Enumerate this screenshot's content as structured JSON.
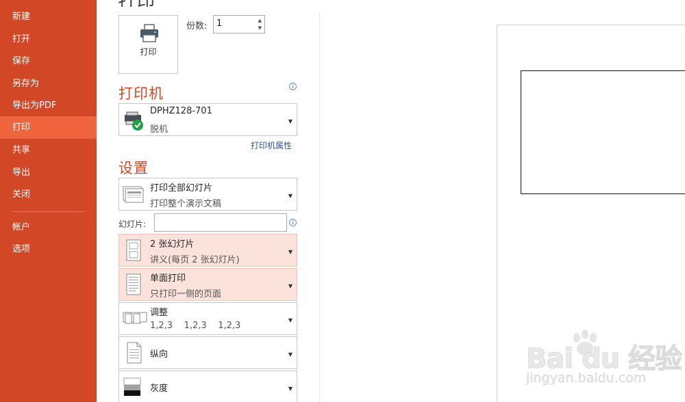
{
  "sidebar": {
    "items": [
      {
        "label": "新建"
      },
      {
        "label": "打开"
      },
      {
        "label": "保存"
      },
      {
        "label": "另存为"
      },
      {
        "label": "导出为PDF"
      },
      {
        "label": "打印",
        "active": true
      },
      {
        "label": "共享"
      },
      {
        "label": "导出"
      },
      {
        "label": "关闭"
      },
      {
        "label": "帐户"
      },
      {
        "label": "选项"
      }
    ]
  },
  "header": {
    "title": "打印"
  },
  "print_button": {
    "label": "打印",
    "icon": "printer-icon"
  },
  "copies": {
    "label": "份数:",
    "value": "1"
  },
  "printer": {
    "heading": "打印机",
    "name": "DPHZ128-701",
    "status": "脱机",
    "properties_link": "打印机属性",
    "icon": "printer-ready-icon"
  },
  "settings": {
    "heading": "设置",
    "range": {
      "title": "打印全部幻灯片",
      "subtitle": "打印整个演示文稿"
    },
    "slides_label": "幻灯片:",
    "slides_value": "",
    "layout": {
      "title": "2 张幻灯片",
      "subtitle": "讲义(每页 2 张幻灯片)"
    },
    "sides": {
      "title": "单面打印",
      "subtitle": "只打印一侧的页面"
    },
    "collate": {
      "title": "调整",
      "subtitle": "1,2,3    1,2,3    1,2,3"
    },
    "orientation": {
      "title": "纵向"
    },
    "color": {
      "title": "灰度"
    }
  },
  "watermark": {
    "logo": "Bai du 经验",
    "url": "jingyan.baidu.com"
  },
  "colors": {
    "sidebar_bg": "#d24726",
    "sidebar_active": "#f0643e",
    "accent": "#d24726",
    "highlight_bg": "#fbe2da",
    "link": "#2b5797"
  }
}
